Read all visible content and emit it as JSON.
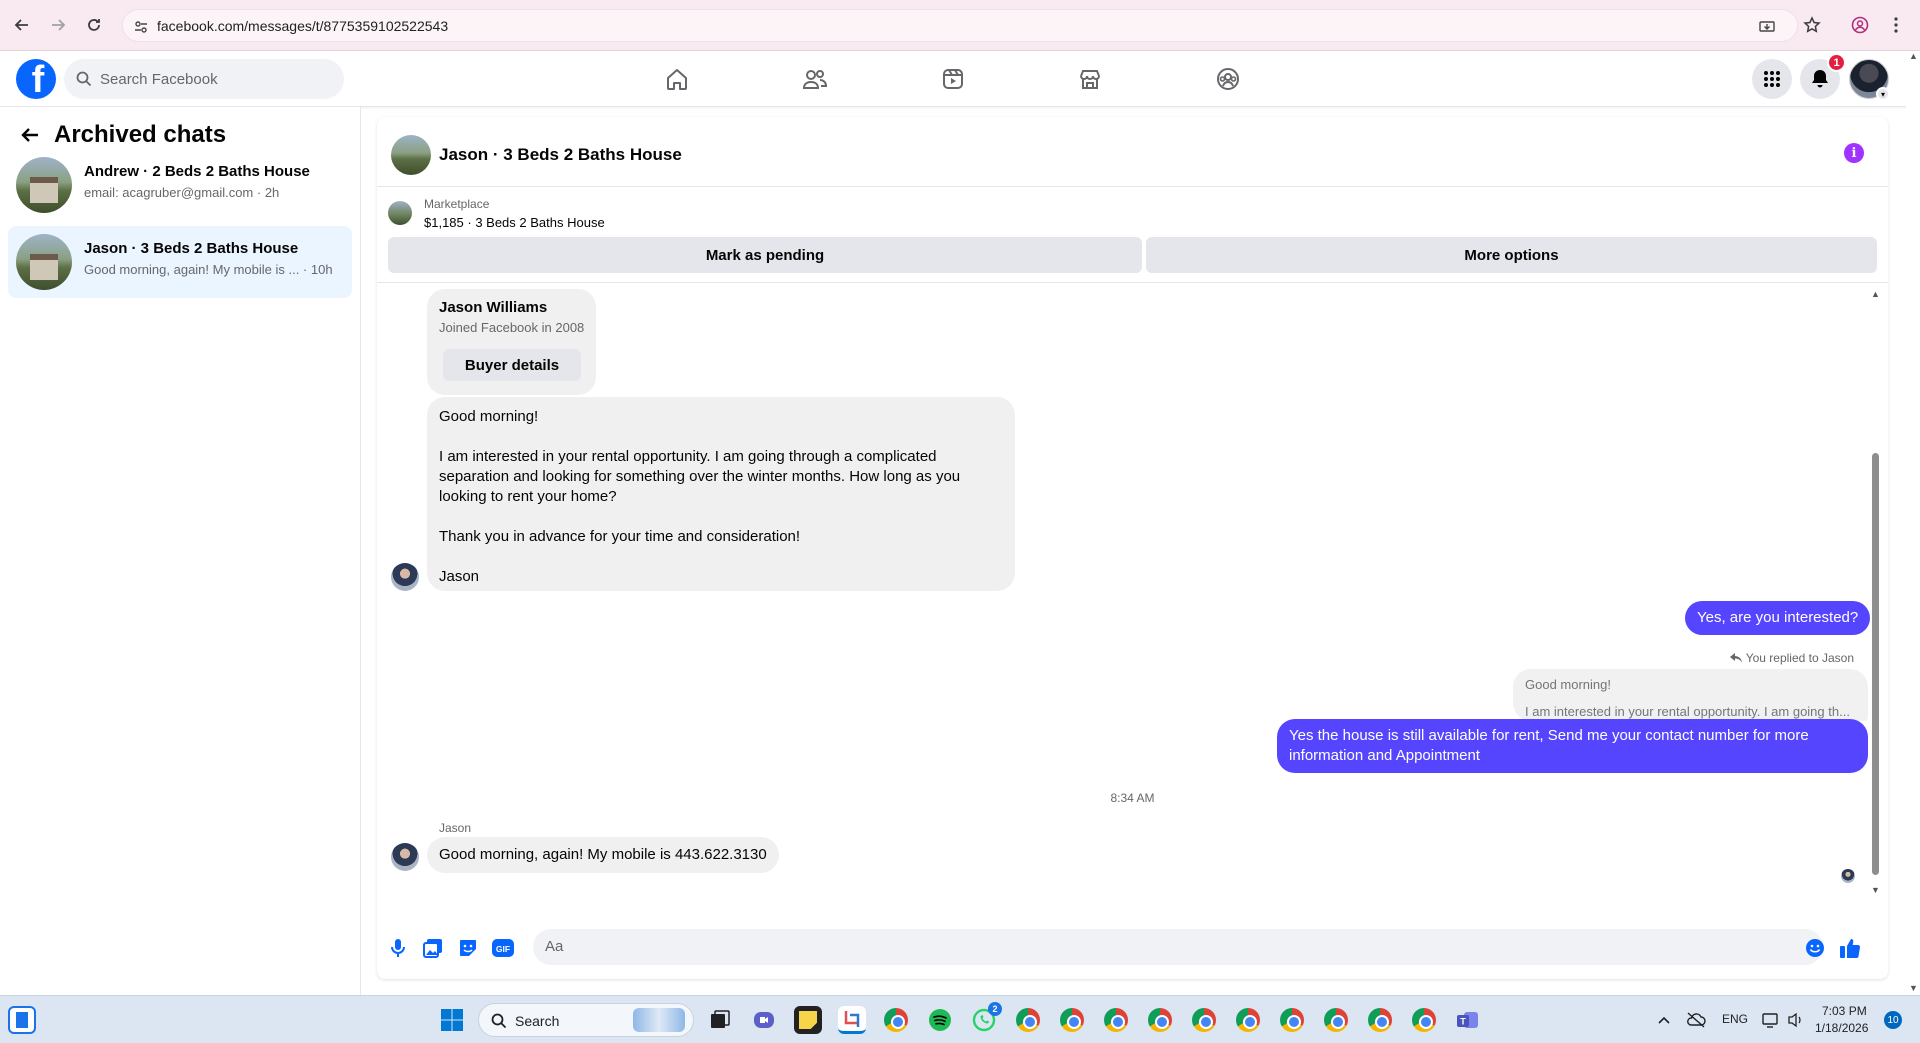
{
  "browser": {
    "url": "facebook.com/messages/t/8775359102522543"
  },
  "header": {
    "search_placeholder": "Search Facebook",
    "notification_count": "1"
  },
  "sidebar": {
    "title": "Archived chats",
    "chats": [
      {
        "name": "Andrew · 2 Beds 2 Baths House",
        "subtitle": "email: acagruber@gmail.com · 2h",
        "active": false
      },
      {
        "name": "Jason · 3 Beds 2 Baths House",
        "subtitle": "Good morning, again! My mobile is ... · 10h",
        "active": true
      }
    ]
  },
  "conversation": {
    "title": "Jason · 3 Beds 2 Baths House",
    "marketplace": {
      "label": "Marketplace",
      "listing": "$1,185 · 3 Beds 2 Baths House",
      "button_pending": "Mark as pending",
      "button_more": "More options"
    },
    "buyer_card": {
      "name": "Jason Williams",
      "joined": "Joined Facebook in 2008",
      "button": "Buyer details"
    },
    "messages": {
      "first_lines": [
        "Good morning!",
        "",
        "I am interested in your rental opportunity. I am going through a complicated",
        "separation and looking for something over the winter months. How long as you",
        "looking to rent your home?",
        "",
        "Thank you in advance for your time and consideration!",
        "",
        "Jason"
      ],
      "reply_1": "Yes, are you interested?",
      "reply_note": "You replied to Jason",
      "quoted_line_1": "Good morning!",
      "quoted_line_2": "I am interested in your rental opportunity. I am going th...",
      "reply_2_line_1": "Yes the house is still available for rent, Send me your contact number for more",
      "reply_2_line_2": "information and Appointment",
      "timestamp": "8:34 AM",
      "sender_label": "Jason",
      "last_message": "Good morning, again! My mobile is 443.622.3130"
    },
    "composer_placeholder": "Aa"
  },
  "taskbar": {
    "search_placeholder": "Search",
    "language": "ENG",
    "time": "7:03 PM",
    "date": "1/18/2026",
    "notification_count": "10",
    "whatsapp_badge": "2"
  }
}
